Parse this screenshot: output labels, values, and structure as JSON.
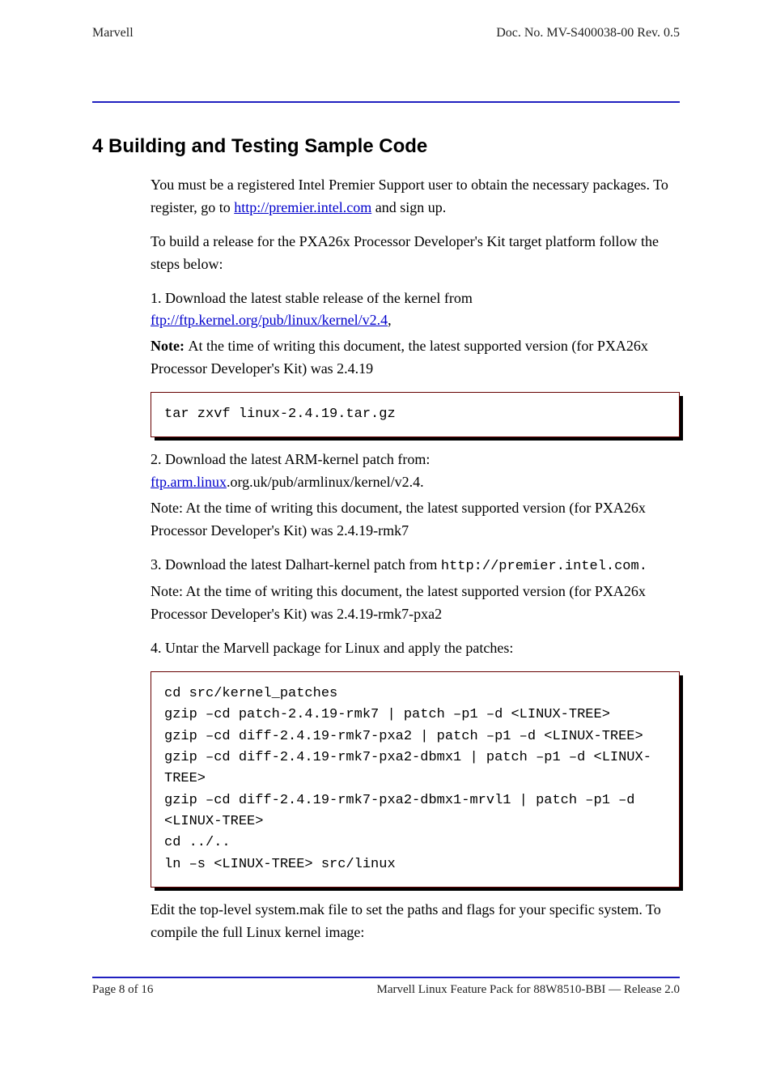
{
  "header": {
    "left": "Marvell",
    "right": "Doc. No. MV-S400038-00 Rev. 0.5"
  },
  "section": {
    "title": "4 Building and Testing Sample Code"
  },
  "para_signup": "You must be a registered Intel Premier Support user to obtain the necessary packages. To register, go to ",
  "link_intel": "http://premier.intel.com",
  "para_signup_tail": " and sign up.",
  "para_steps": "To build a release for the PXA26x Processor Developer's Kit target platform follow the steps below:",
  "list1": {
    "prefix": "1. Download the latest stable release of the kernel from ",
    "link": "ftp://ftp.kernel.org/pub/linux/kernel/v2.4",
    "tail": ",",
    "note_lead": "Note: ",
    "note": "At the time of writing this document, the latest supported version (for PXA26x Processor Developer's Kit) was 2.4.19",
    "cmd": "tar zxvf linux-2.4.19.tar.gz"
  },
  "list2": {
    "prefix": "2. Download the latest ARM-kernel patch from: ",
    "link": "ftp.arm.linux",
    "tail": ".org.uk/pub/armlinux/kernel/v2.4.",
    "note": "Note: At the time of writing this document, the latest supported version (for PXA26x Processor Developer's Kit) was 2.4.19-rmk7"
  },
  "list3": {
    "text": "3. Download the latest Dalhart-kernel patch from ",
    "mono": "http://premier.intel.com.",
    "note": "Note: At the time of writing this document, the latest supported version (for PXA26x Processor Developer's Kit) was 2.4.19-rmk7-pxa2"
  },
  "list4": "4. Untar the Marvell package for Linux and apply the patches:",
  "codebox": "cd src/kernel_patches\ngzip –cd patch-2.4.19-rmk7 | patch –p1 –d <LINUX-TREE>\ngzip –cd diff-2.4.19-rmk7-pxa2 | patch –p1 –d <LINUX-TREE>\ngzip –cd diff-2.4.19-rmk7-pxa2-dbmx1 | patch –p1 –d <LINUX-\nTREE>\ngzip –cd diff-2.4.19-rmk7-pxa2-dbmx1-mrvl1 | patch –p1 –d\n<LINUX-TREE>\ncd ../..\nln –s <LINUX-TREE> src/linux",
  "para5": "Edit the top-level system.mak file to set the paths and flags for your specific system. To compile the full Linux kernel image:",
  "footer": {
    "left": "Page 8 of 16",
    "right": "Marvell Linux Feature Pack for 88W8510-BBI — Release 2.0"
  }
}
